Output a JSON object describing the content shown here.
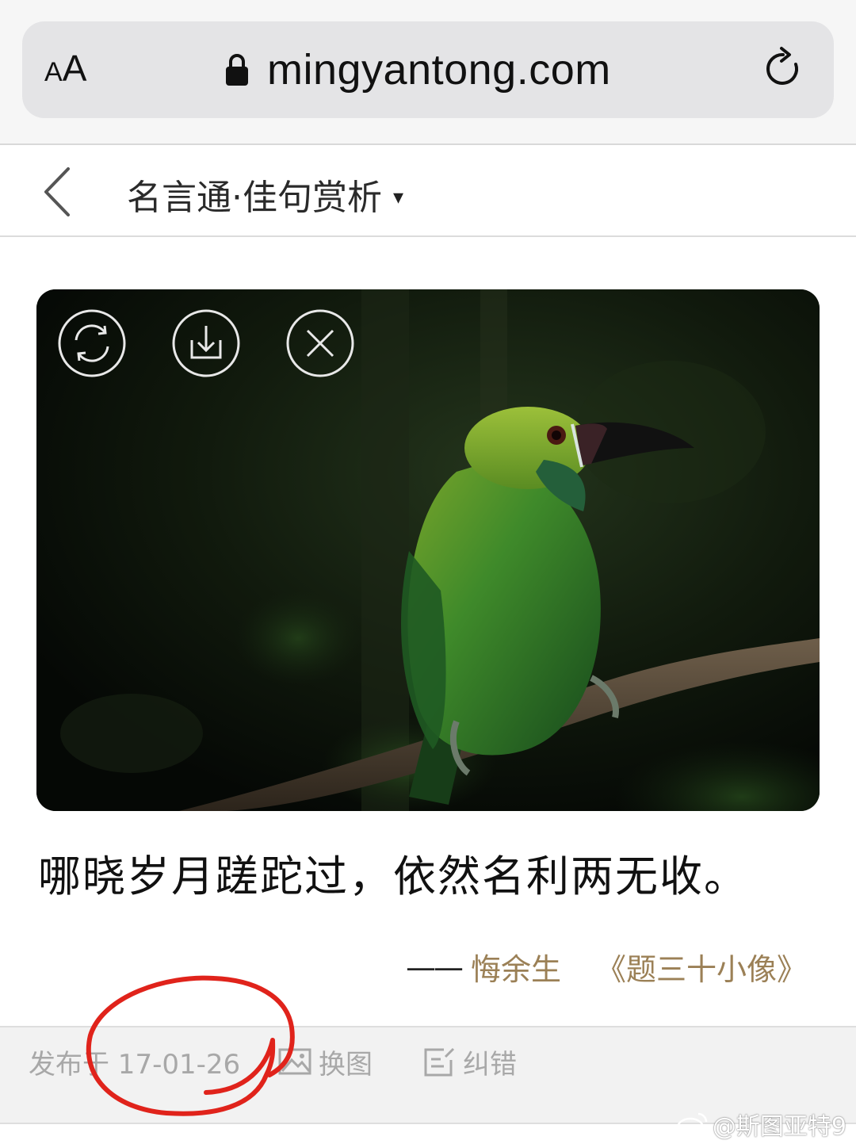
{
  "browser": {
    "text_size_button": {
      "small": "A",
      "big": "A"
    },
    "url": "mingyantong.com"
  },
  "header": {
    "title": "名言通·佳句赏析",
    "caret": "▾"
  },
  "quote": {
    "text": "哪晓岁月蹉跎过，依然名利两无收。",
    "dash": "——",
    "author": "悔余生",
    "source": "《题三十小像》"
  },
  "meta": {
    "published": "发布于 17-01-26",
    "change_image": "换图",
    "report_error": "纠错"
  },
  "watermark": {
    "text": "@斯图亚特9"
  },
  "colors": {
    "attribution": "#9b8056",
    "meta_text": "#a8a8a8",
    "annotation": "#e0231b"
  }
}
